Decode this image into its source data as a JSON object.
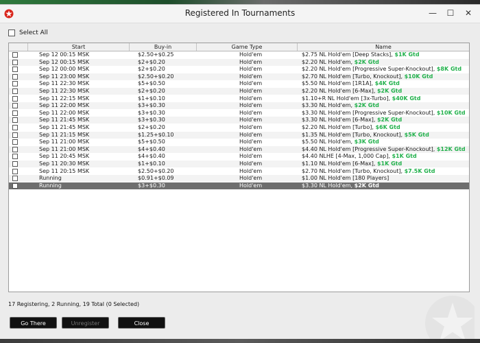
{
  "window": {
    "title": "Registered In Tournaments"
  },
  "controls": {
    "minimize": "—",
    "maximize": "☐",
    "close": "✕"
  },
  "select_all_label": "Select All",
  "columns": [
    "Start",
    "Buy-in",
    "Game Type",
    "Name"
  ],
  "rows": [
    {
      "start": "Sep 12  00:15 MSK",
      "buyin": "$2.50+$0.25",
      "game": "Hold'em",
      "name": "$2.75 NL Hold'em [Deep Stacks], ",
      "gtd": "$1K Gtd"
    },
    {
      "start": "Sep 12  00:15 MSK",
      "buyin": "$2+$0.20",
      "game": "Hold'em",
      "name": "$2.20 NL Hold'em, ",
      "gtd": "$2K Gtd"
    },
    {
      "start": "Sep 12  00:00 MSK",
      "buyin": "$2+$0.20",
      "game": "Hold'em",
      "name": "$2.20 NL Hold'em [Progressive Super-Knockout], ",
      "gtd": "$8K Gtd"
    },
    {
      "start": "Sep 11  23:00 MSK",
      "buyin": "$2.50+$0.20",
      "game": "Hold'em",
      "name": "$2.70 NL Hold'em [Turbo, Knockout], ",
      "gtd": "$10K Gtd"
    },
    {
      "start": "Sep 11  22:30 MSK",
      "buyin": "$5+$0.50",
      "game": "Hold'em",
      "name": "$5.50 NL Hold'em [1R1A], ",
      "gtd": "$4K Gtd"
    },
    {
      "start": "Sep 11  22:30 MSK",
      "buyin": "$2+$0.20",
      "game": "Hold'em",
      "name": "$2.20 NL Hold'em [6-Max], ",
      "gtd": "$2K Gtd"
    },
    {
      "start": "Sep 11  22:15 MSK",
      "buyin": "$1+$0.10",
      "game": "Hold'em",
      "name": "$1.10+R NL Hold'em [3x-Turbo], ",
      "gtd": "$40K Gtd"
    },
    {
      "start": "Sep 11  22:00 MSK",
      "buyin": "$3+$0.30",
      "game": "Hold'em",
      "name": "$3.30 NL Hold'em, ",
      "gtd": "$2K Gtd"
    },
    {
      "start": "Sep 11  22:00 MSK",
      "buyin": "$3+$0.30",
      "game": "Hold'em",
      "name": "$3.30 NL Hold'em [Progressive Super-Knockout], ",
      "gtd": "$10K Gtd"
    },
    {
      "start": "Sep 11  21:45 MSK",
      "buyin": "$3+$0.30",
      "game": "Hold'em",
      "name": "$3.30 NL Hold'em [6-Max], ",
      "gtd": "$2K Gtd"
    },
    {
      "start": "Sep 11  21:45 MSK",
      "buyin": "$2+$0.20",
      "game": "Hold'em",
      "name": "$2.20 NL Hold'em [Turbo], ",
      "gtd": "$6K Gtd"
    },
    {
      "start": "Sep 11  21:15 MSK",
      "buyin": "$1.25+$0.10",
      "game": "Hold'em",
      "name": "$1.35 NL Hold'em [Turbo, Knockout], ",
      "gtd": "$5K Gtd"
    },
    {
      "start": "Sep 11  21:00 MSK",
      "buyin": "$5+$0.50",
      "game": "Hold'em",
      "name": "$5.50 NL Hold'em, ",
      "gtd": "$3K Gtd"
    },
    {
      "start": "Sep 11  21:00 MSK",
      "buyin": "$4+$0.40",
      "game": "Hold'em",
      "name": "$4.40 NL Hold'em [Progressive Super-Knockout], ",
      "gtd": "$12K Gtd"
    },
    {
      "start": "Sep 11  20:45 MSK",
      "buyin": "$4+$0.40",
      "game": "Hold'em",
      "name": "$4.40 NLHE [4-Max, 1,000 Cap], ",
      "gtd": "$1K Gtd"
    },
    {
      "start": "Sep 11  20:30 MSK",
      "buyin": "$1+$0.10",
      "game": "Hold'em",
      "name": "$1.10 NL Hold'em [6-Max], ",
      "gtd": "$1K Gtd"
    },
    {
      "start": "Sep 11  20:15 MSK",
      "buyin": "$2.50+$0.20",
      "game": "Hold'em",
      "name": "$2.70 NL Hold'em [Turbo, Knockout], ",
      "gtd": "$7.5K Gtd"
    },
    {
      "start": "Running",
      "buyin": "$0.91+$0.09",
      "game": "Hold'em",
      "name": "$1.00 NL Hold'em [180 Players]",
      "gtd": ""
    },
    {
      "start": "Running",
      "buyin": "$3+$0.30",
      "game": "Hold'em",
      "name": "$3.30 NL Hold'em, ",
      "gtd": "$2K Gtd",
      "selected": true
    }
  ],
  "status_text": "17 Registering, 2 Running, 19 Total (0 Selected)",
  "buttons": {
    "go_there": "Go There",
    "unregister": "Unregister",
    "close": "Close"
  },
  "colors": {
    "guarantee": "#22b14c",
    "selected_row": "#6e6e6e",
    "brand": "#d9261c"
  },
  "icons": {
    "app_logo": "pokerstars-star-icon",
    "watermark": "pokerstars-watermark-icon"
  }
}
